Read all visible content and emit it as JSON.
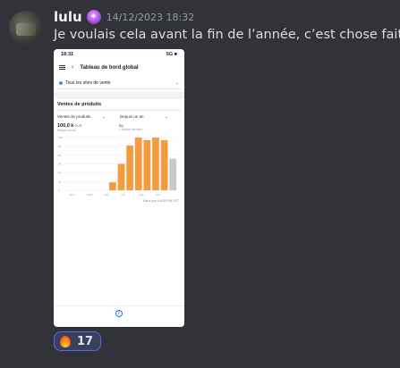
{
  "message": {
    "username": "lulu",
    "timestamp": "14/12/2023 18:32",
    "text": "Je voulais cela avant la fin de l’année, c’est chose faite",
    "role_icon": "crystal-ball-icon",
    "emoji": "raising-hands-icon"
  },
  "attachment": {
    "status_time": "18:31",
    "status_right": "5G ■",
    "title": "Tableau de bord global",
    "sites_filter": "Tous les sites de vente",
    "section_title": "Ventes de produits",
    "select_left": "Ventes de produits",
    "select_right": "Depuis un an",
    "metric_value": "100,0 k",
    "metric_unit": "EUR",
    "metric_sub": "Depuis un an",
    "metric2_value": "kg",
    "metric2_sub": "L.année dernière",
    "updated_text": "Mis à jour à 6:30 PM CET",
    "chart_data": {
      "type": "bar",
      "categories": [
        "janv.",
        "mars",
        "mai",
        "juil.",
        "sept.",
        "nov."
      ],
      "values": [
        0,
        0,
        0,
        0,
        0,
        1.5,
        5,
        8.5,
        10,
        9.5,
        10,
        9.5,
        6
      ],
      "colors": {
        "bar": "#f79a3e",
        "last_bar": "#c9c9c9"
      },
      "y_ticks": [
        "10k",
        "9k",
        "8k",
        "6k",
        "4k",
        "2k",
        "0"
      ]
    }
  },
  "reaction": {
    "icon": "fire-icon",
    "count": "17"
  }
}
